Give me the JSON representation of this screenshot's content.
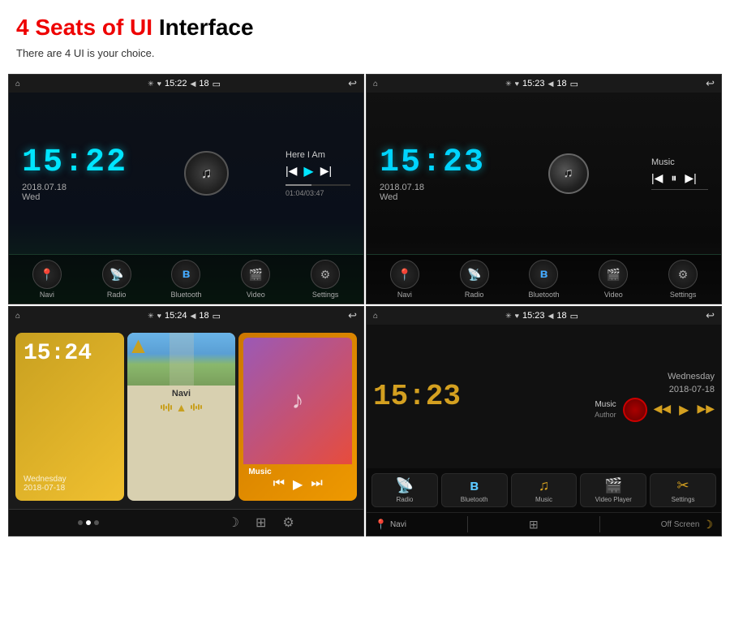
{
  "header": {
    "title_part1": "4 Seats of UI",
    "title_part2": "Interface",
    "subtitle": "There are 4 UI is your choice."
  },
  "statusbar": {
    "time1": "15:22",
    "time2": "15:23",
    "time3": "15:24",
    "time4": "15:23",
    "battery": "18"
  },
  "ui1": {
    "clock": "15:22",
    "date": "2018.07.18",
    "day": "Wed",
    "music_title": "Here I Am",
    "music_time": "01:04/03:47",
    "nav_items": [
      "Navi",
      "Radio",
      "Bluetooth",
      "Video",
      "Settings"
    ]
  },
  "ui2": {
    "clock": "15:23",
    "date": "2018.07.18",
    "day": "Wed",
    "music_title": "Music",
    "nav_items": [
      "Navi",
      "Radio",
      "Bluetooth",
      "Video",
      "Settings"
    ]
  },
  "ui3": {
    "clock": "15:24",
    "date_label": "Wednesday",
    "date": "2018-07-18",
    "card_navi": "Navi",
    "card_music": "Music"
  },
  "ui4": {
    "clock": "15:23",
    "day": "Wednesday",
    "date": "2018-07-18",
    "music_label": "Music",
    "author_label": "Author",
    "icons": [
      "Radio",
      "Bluetooth",
      "Music",
      "Video Player",
      "Settings"
    ],
    "footer_left": "Navi",
    "footer_right": "Off Screen"
  }
}
